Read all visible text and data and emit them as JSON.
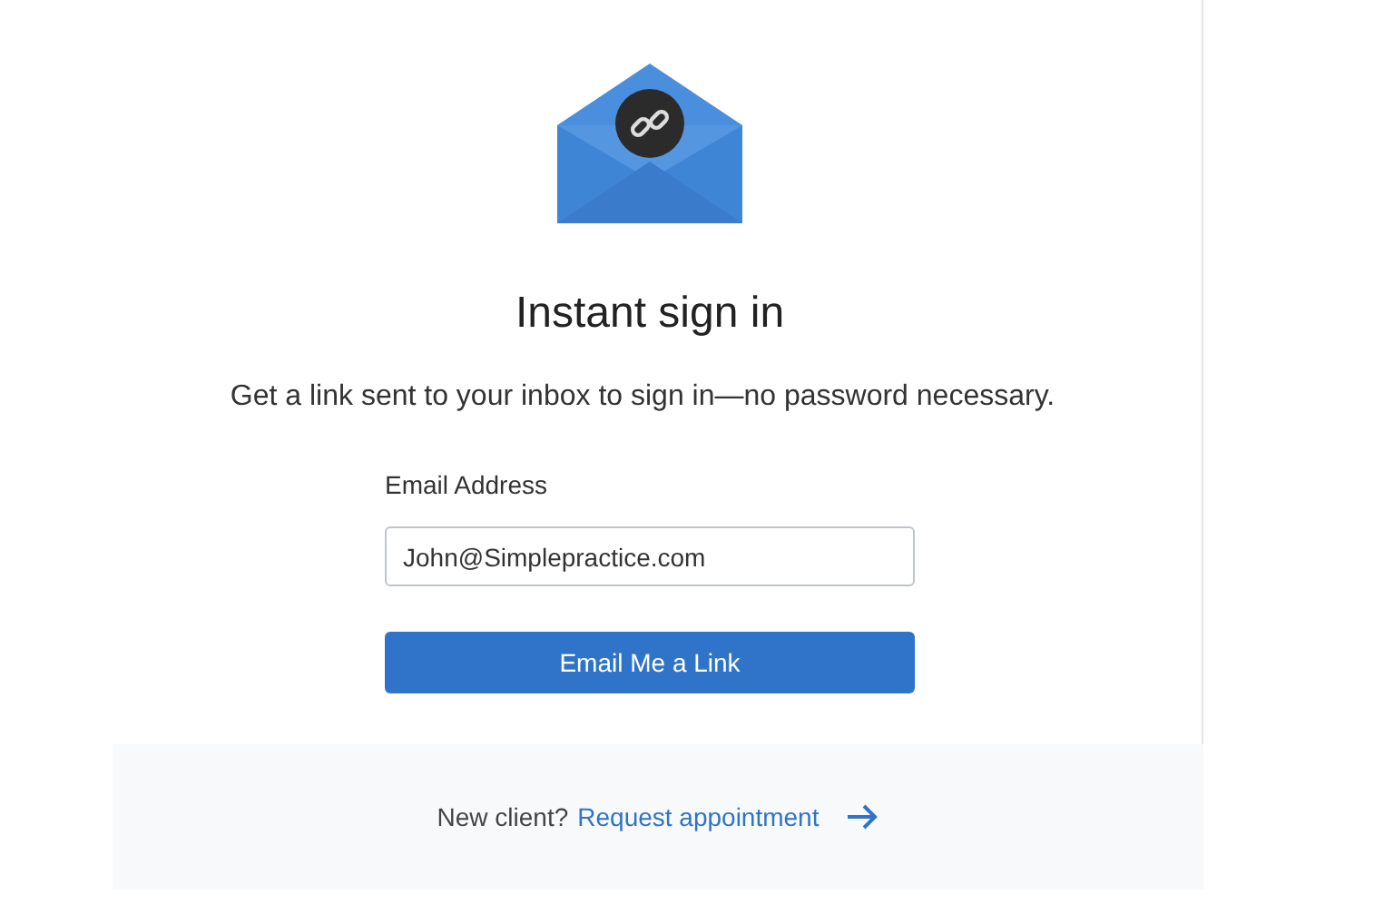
{
  "title": "Instant sign in",
  "subtitle": "Get a link sent to your inbox to sign in—no password necessary.",
  "email": {
    "label": "Email Address",
    "value": "John@Simplepractice.com"
  },
  "submit": "Email Me a Link",
  "footer": {
    "prompt": "New client?",
    "link": "Request appointment"
  }
}
